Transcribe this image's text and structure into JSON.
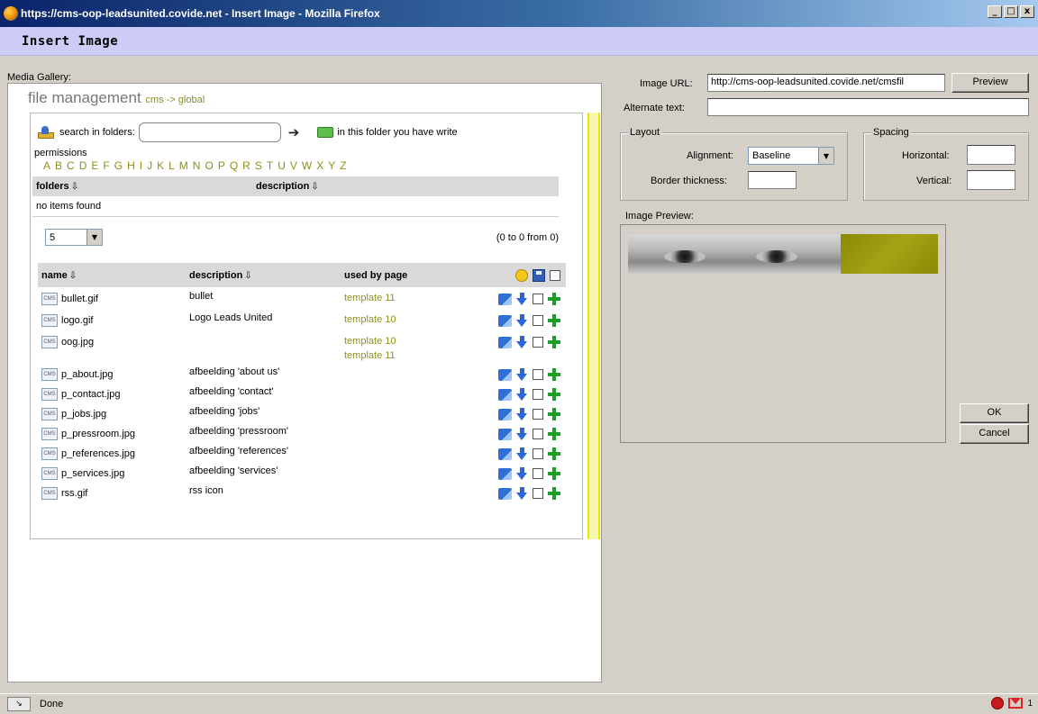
{
  "window": {
    "title": "https://cms-oop-leadsunited.covide.net - Insert Image - Mozilla Firefox",
    "buttons": [
      "_",
      "□",
      "x"
    ]
  },
  "dialog": {
    "title": "Insert Image"
  },
  "gallery": {
    "label": "Media Gallery:",
    "heading": "file management",
    "breadcrumb": "cms -> global",
    "search_label": "search in folders:",
    "search_value": "",
    "write_notice": "in this folder you have write",
    "permissions": "permissions",
    "alphabet": [
      "A",
      "B",
      "C",
      "D",
      "E",
      "F",
      "G",
      "H",
      "I",
      "J",
      "K",
      "L",
      "M",
      "N",
      "O",
      "P",
      "Q",
      "R",
      "S",
      "T",
      "U",
      "V",
      "W",
      "X",
      "Y",
      "Z"
    ],
    "folders_table": {
      "headers": [
        "folders",
        "description"
      ],
      "empty_text": "no items found"
    },
    "page_size": "5",
    "range_text": "(0 to 0 from 0)",
    "files_table": {
      "headers": [
        "name",
        "description",
        "used by page"
      ],
      "rows": [
        {
          "name": "bullet.gif",
          "description": "bullet",
          "used": [
            "template 11"
          ]
        },
        {
          "name": "logo.gif",
          "description": "Logo Leads United",
          "used": [
            "template 10"
          ]
        },
        {
          "name": "oog.jpg",
          "description": "",
          "used": [
            "template 10",
            "template 11"
          ]
        },
        {
          "name": "p_about.jpg",
          "description": "afbeelding 'about us'",
          "used": []
        },
        {
          "name": "p_contact.jpg",
          "description": "afbeelding 'contact'",
          "used": []
        },
        {
          "name": "p_jobs.jpg",
          "description": "afbeelding 'jobs'",
          "used": []
        },
        {
          "name": "p_pressroom.jpg",
          "description": "afbeelding 'pressroom'",
          "used": []
        },
        {
          "name": "p_references.jpg",
          "description": "afbeelding 'references'",
          "used": []
        },
        {
          "name": "p_services.jpg",
          "description": "afbeelding 'services'",
          "used": []
        },
        {
          "name": "rss.gif",
          "description": "rss icon",
          "used": []
        }
      ]
    }
  },
  "image_props": {
    "url_label": "Image URL:",
    "url_value": "http://cms-oop-leadsunited.covide.net/cmsfil",
    "preview_button": "Preview",
    "alt_label": "Alternate text:",
    "alt_value": "",
    "layout_legend": "Layout",
    "alignment_label": "Alignment:",
    "alignment_value": "Baseline",
    "border_label": "Border thickness:",
    "border_value": "",
    "spacing_legend": "Spacing",
    "horizontal_label": "Horizontal:",
    "horizontal_value": "",
    "vertical_label": "Vertical:",
    "vertical_value": "",
    "preview_label": "Image Preview:",
    "ok_button": "OK",
    "cancel_button": "Cancel"
  },
  "status": {
    "text": "Done",
    "mail_count": "1"
  },
  "colors": {
    "accent_olive": "#8f8f1e",
    "header_lavender": "#ccccf6",
    "yellow_bar": "#e8e800"
  }
}
